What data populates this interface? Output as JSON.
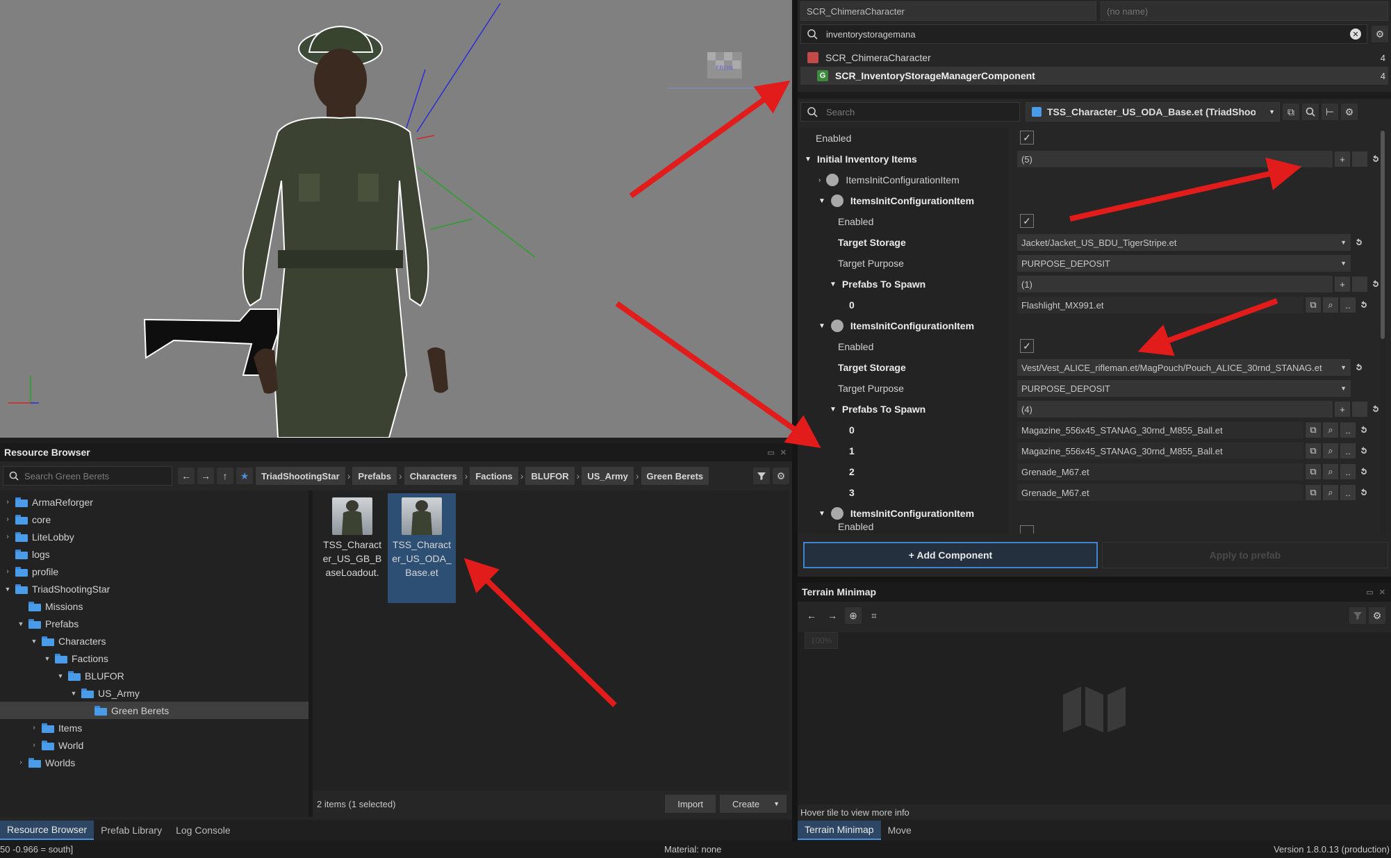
{
  "viewport": {
    "front_label": "FRON"
  },
  "resource_browser": {
    "title": "Resource Browser",
    "search_placeholder": "Search Green Berets",
    "breadcrumb": [
      "TriadShootingStar",
      "Prefabs",
      "Characters",
      "Factions",
      "BLUFOR",
      "US_Army",
      "Green Berets"
    ],
    "tree": [
      {
        "label": "ArmaReforger",
        "depth": 0,
        "arrow": "›"
      },
      {
        "label": "core",
        "depth": 0,
        "arrow": "›"
      },
      {
        "label": "LiteLobby",
        "depth": 0,
        "arrow": "›"
      },
      {
        "label": "logs",
        "depth": 0,
        "arrow": ""
      },
      {
        "label": "profile",
        "depth": 0,
        "arrow": "›"
      },
      {
        "label": "TriadShootingStar",
        "depth": 0,
        "arrow": "⌄"
      },
      {
        "label": "Missions",
        "depth": 1,
        "arrow": ""
      },
      {
        "label": "Prefabs",
        "depth": 1,
        "arrow": "⌄"
      },
      {
        "label": "Characters",
        "depth": 2,
        "arrow": "⌄"
      },
      {
        "label": "Factions",
        "depth": 3,
        "arrow": "⌄"
      },
      {
        "label": "BLUFOR",
        "depth": 4,
        "arrow": "⌄"
      },
      {
        "label": "US_Army",
        "depth": 5,
        "arrow": "⌄"
      },
      {
        "label": "Green Berets",
        "depth": 6,
        "arrow": "",
        "selected": true
      },
      {
        "label": "Items",
        "depth": 2,
        "arrow": "›"
      },
      {
        "label": "World",
        "depth": 2,
        "arrow": "›"
      },
      {
        "label": "Worlds",
        "depth": 1,
        "arrow": "›"
      }
    ],
    "assets": [
      {
        "label": "TSS_Charact er_US_GB_B aseLoadout.",
        "selected": false
      },
      {
        "label": "TSS_Charact er_US_ODA_ Base.et",
        "selected": true
      }
    ],
    "item_count": "2 items (1 selected)",
    "import_label": "Import",
    "create_label": "Create"
  },
  "bottom_tabs_left": [
    "Resource Browser",
    "Prefab Library",
    "Log Console"
  ],
  "inspector": {
    "entity_class": "SCR_ChimeraCharacter",
    "entity_name_placeholder": "(no name)",
    "component_search": "inventorystoragemana",
    "results": [
      {
        "label": "SCR_ChimeraCharacter",
        "count": "4",
        "bold": false
      },
      {
        "label": "SCR_InventoryStorageManagerComponent",
        "count": "4",
        "bold": true
      }
    ],
    "prop_search_placeholder": "Search",
    "prefab_name": "TSS_Character_US_ODA_Base.et (TriadShoo",
    "props": {
      "enabled": "Enabled",
      "initial_inventory_items": "Initial Inventory Items",
      "initial_count": "(5)",
      "item_config": "ItemsInitConfigurationItem",
      "target_storage": "Target Storage",
      "target_purpose": "Target Purpose",
      "prefabs_to_spawn": "Prefabs To Spawn",
      "storage_1": "Jacket/Jacket_US_BDU_TigerStripe.et",
      "purpose_1": "PURPOSE_DEPOSIT",
      "prefab_count_1": "(1)",
      "prefab_1_0": "Flashlight_MX991.et",
      "storage_2": "Vest/Vest_ALICE_rifleman.et/MagPouch/Pouch_ALICE_30rnd_STANAG.et",
      "purpose_2": "PURPOSE_DEPOSIT",
      "prefab_count_2": "(4)",
      "prefab_2_0": "Magazine_556x45_STANAG_30rnd_M855_Ball.et",
      "prefab_2_1": "Magazine_556x45_STANAG_30rnd_M855_Ball.et",
      "prefab_2_2": "Grenade_M67.et",
      "prefab_2_3": "Grenade_M67.et",
      "idx0": "0",
      "idx1": "1",
      "idx2": "2",
      "idx3": "3",
      "partial": "Enabled"
    },
    "add_component": "+ Add Component",
    "apply_to_prefab": "Apply to prefab"
  },
  "minimap": {
    "title": "Terrain Minimap",
    "zoom": "100%",
    "hover_hint": "Hover tile to view more info"
  },
  "bottom_tabs_right": [
    "Terrain Minimap",
    "Move"
  ],
  "status_bar": {
    "left": "50 -0.966 = south]",
    "center": "Material: none",
    "right": "Version 1.8.0.13 (production)"
  },
  "colors": {
    "accent": "#3f86d1",
    "arrow_red": "#e21b1b",
    "folder_blue": "#4a9be8"
  }
}
